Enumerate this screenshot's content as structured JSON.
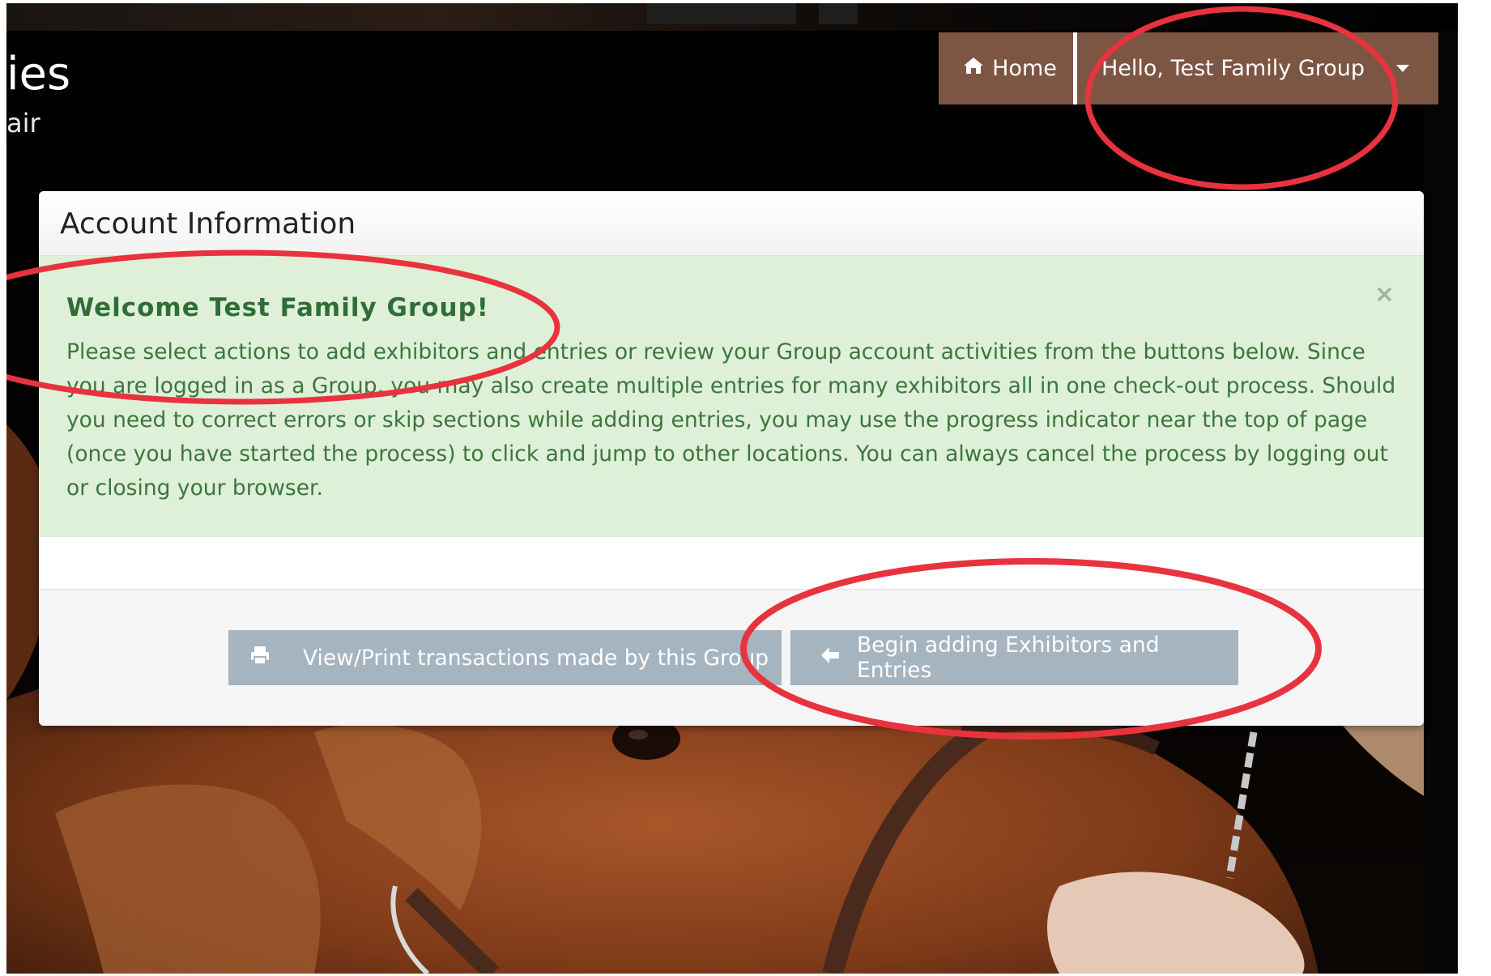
{
  "brand": {
    "title_fragment": "ies",
    "subtitle_fragment": "air"
  },
  "navbar": {
    "home_label": "Home",
    "user_label": "Hello, Test Family Group"
  },
  "panel": {
    "title": "Account Information",
    "alert": {
      "heading": "Welcome Test Family Group!",
      "body": "Please select actions to add exhibitors and entries or review your Group account activities from the buttons below. Since you are logged in as a Group, you may also create multiple entries for many exhibitors all in one check-out process. Should you need to correct errors or skip sections while adding entries, you may use the progress indicator near the top of page (once you have started the process) to click and jump to other locations. You can always cancel the process by logging out or closing your browser.",
      "close_symbol": "×"
    },
    "buttons": {
      "print_label": "View/Print transactions made by this Group",
      "begin_label": "Begin adding Exhibitors and Entries"
    }
  },
  "icons": {
    "home": "home-icon",
    "caret": "caret-down-icon",
    "print": "printer-icon",
    "arrow": "arrow-left-icon",
    "close": "close-icon"
  },
  "colors": {
    "nav_brown": "#7d5543",
    "alert_green_bg": "#dff0d8",
    "alert_green_text": "#3c763d",
    "button_gray": "#a6b4c0",
    "annotation_red": "#e8333f"
  }
}
